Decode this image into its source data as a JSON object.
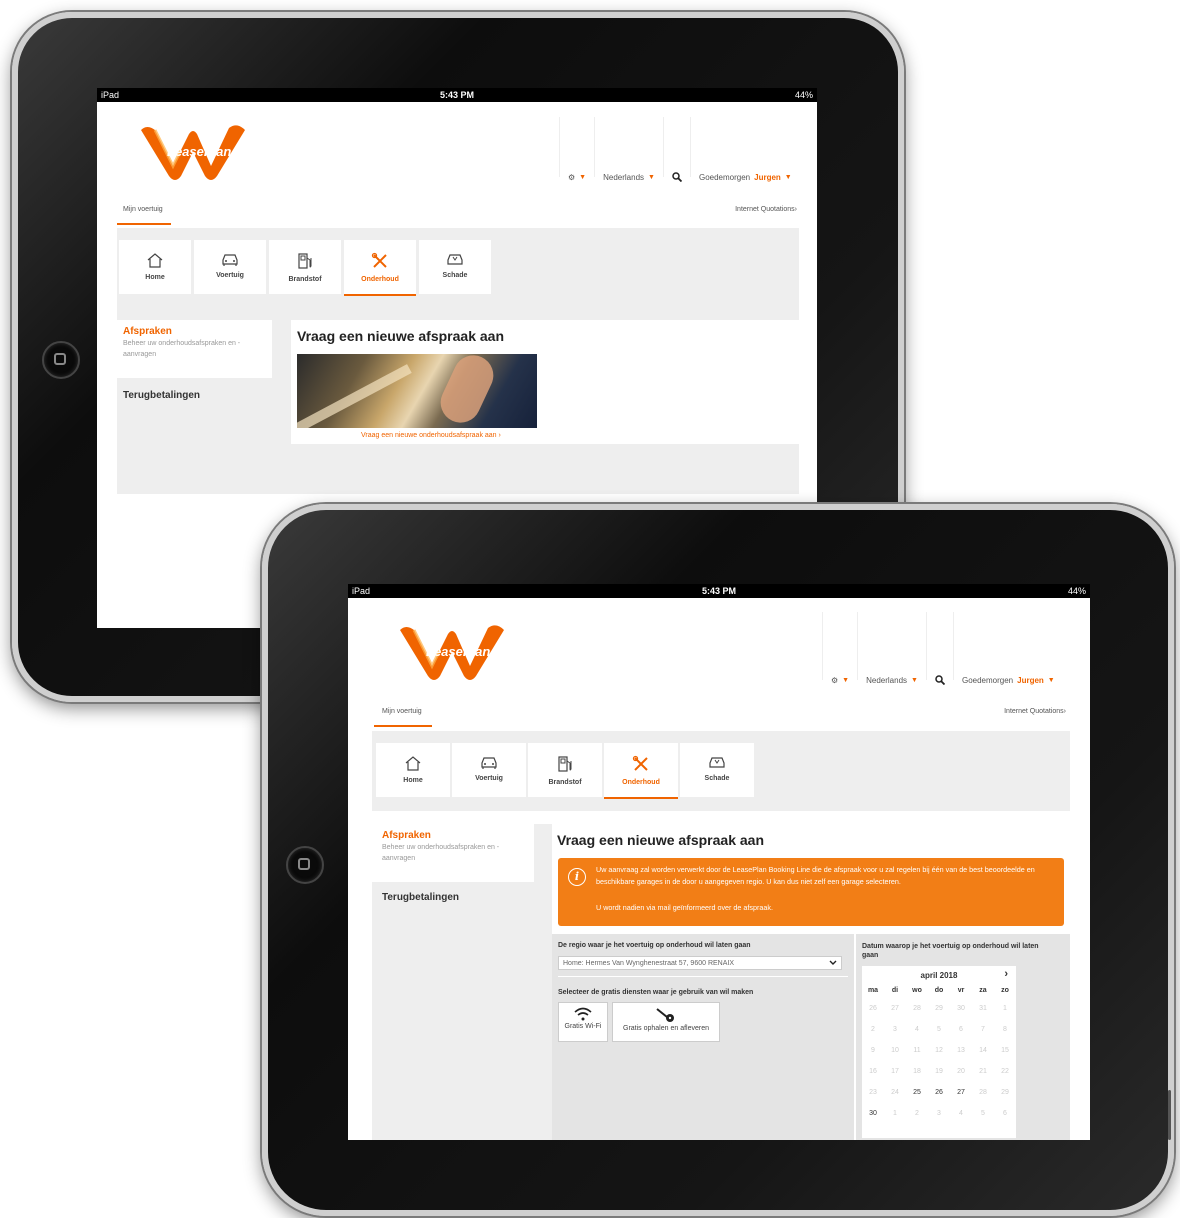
{
  "status_bar": {
    "carrier": "iPad",
    "time": "5:43 PM",
    "battery": "44%"
  },
  "brand": {
    "name": "LeasePlan",
    "accent": "#f06400",
    "accent_box": "#f27e16"
  },
  "header": {
    "language": "Nederlands",
    "greeting": "Goedemorgen",
    "user_name": "Jurgen",
    "settings_icon": "gear-icon",
    "search_icon": "search-icon"
  },
  "tabs": {
    "active": "Mijn voertuig",
    "right_link": "Internet Quotations"
  },
  "nav_tiles": [
    {
      "label": "Home",
      "icon": "home-icon"
    },
    {
      "label": "Voertuig",
      "icon": "car-icon"
    },
    {
      "label": "Brandstof",
      "icon": "fuel-pump-icon"
    },
    {
      "label": "Onderhoud",
      "icon": "wrench-icon",
      "active": true
    },
    {
      "label": "Schade",
      "icon": "damaged-car-icon"
    }
  ],
  "sidebar": {
    "appointments_title": "Afspraken",
    "appointments_desc": "Beheer uw onderhoudsafspraken en -aanvragen",
    "refunds": "Terugbetalingen"
  },
  "screen1": {
    "heading": "Vraag een nieuwe afspraak aan",
    "link": "Vraag een nieuwe onderhoudsafspraak aan"
  },
  "screen2": {
    "heading": "Vraag een nieuwe afspraak aan",
    "info_line1": "Uw aanvraag zal worden verwerkt door de LeasePlan Booking Line die de afspraak voor u zal regelen bij één van de best beoordeelde en beschikbare garages in de door u aangegeven regio. U kan dus niet zelf een garage selecteren.",
    "info_line2": "U wordt nadien via mail geïnformeerd over de afspraak.",
    "region_label": "De regio waar je het voertuig op onderhoud wil laten gaan",
    "region_value": "Home: Hermes Van Wynghenestraat 57, 9600 RENAIX",
    "services_label": "Selecteer de gratis diensten waar je gebruik van wil maken",
    "services": [
      {
        "label": "Gratis Wi-Fi",
        "icon": "wifi-icon"
      },
      {
        "label": "Gratis ophalen en afleveren",
        "icon": "car-key-icon"
      }
    ],
    "date_label": "Datum waarop je het voertuig op onderhoud wil laten gaan",
    "calendar": {
      "month": "april 2018",
      "day_names": [
        "ma",
        "di",
        "wo",
        "do",
        "vr",
        "za",
        "zo"
      ],
      "weeks": [
        [
          "26",
          "27",
          "28",
          "29",
          "30",
          "31",
          "1"
        ],
        [
          "2",
          "3",
          "4",
          "5",
          "6",
          "7",
          "8"
        ],
        [
          "9",
          "10",
          "11",
          "12",
          "13",
          "14",
          "15"
        ],
        [
          "16",
          "17",
          "18",
          "19",
          "20",
          "21",
          "22"
        ],
        [
          "23",
          "24",
          "25",
          "26",
          "27",
          "28",
          "29"
        ],
        [
          "30",
          "1",
          "2",
          "3",
          "4",
          "5",
          "6"
        ]
      ],
      "available": [
        "25",
        "26",
        "27",
        "30"
      ]
    }
  }
}
